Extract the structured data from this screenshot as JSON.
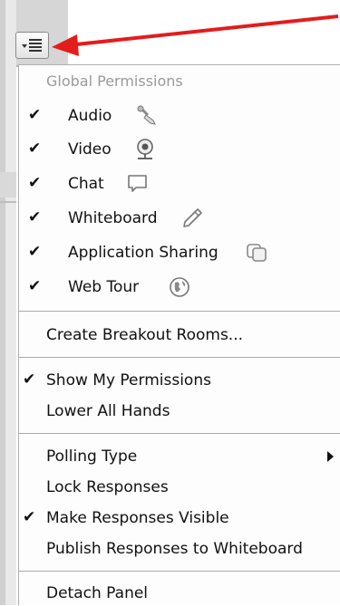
{
  "trigger": {
    "icon": "menu-list-icon"
  },
  "dropdown": {
    "permissions_header": "Global Permissions",
    "permissions": [
      {
        "label": "Audio",
        "checked": true,
        "icon": "mic-pen-icon"
      },
      {
        "label": "Video",
        "checked": true,
        "icon": "webcam-icon"
      },
      {
        "label": "Chat",
        "checked": true,
        "icon": "chat-bubble-icon"
      },
      {
        "label": "Whiteboard",
        "checked": true,
        "icon": "pencil-icon"
      },
      {
        "label": "Application Sharing",
        "checked": true,
        "icon": "app-sharing-icon"
      },
      {
        "label": "Web Tour",
        "checked": true,
        "icon": "globe-icon"
      }
    ],
    "create_breakout_rooms": "Create Breakout Rooms...",
    "show_my_permissions": {
      "label": "Show My Permissions",
      "checked": true
    },
    "lower_all_hands": "Lower All Hands",
    "polling_type": "Polling Type",
    "lock_responses": "Lock Responses",
    "make_responses_visible": {
      "label": "Make Responses Visible",
      "checked": true
    },
    "publish_responses": "Publish Responses to Whiteboard",
    "detach_panel": "Detach Panel",
    "check_mark": "✔"
  },
  "colors": {
    "arrow": "#e41c1c",
    "header_text": "#9a9a9a",
    "icon_gray": "#8a8a8a"
  }
}
